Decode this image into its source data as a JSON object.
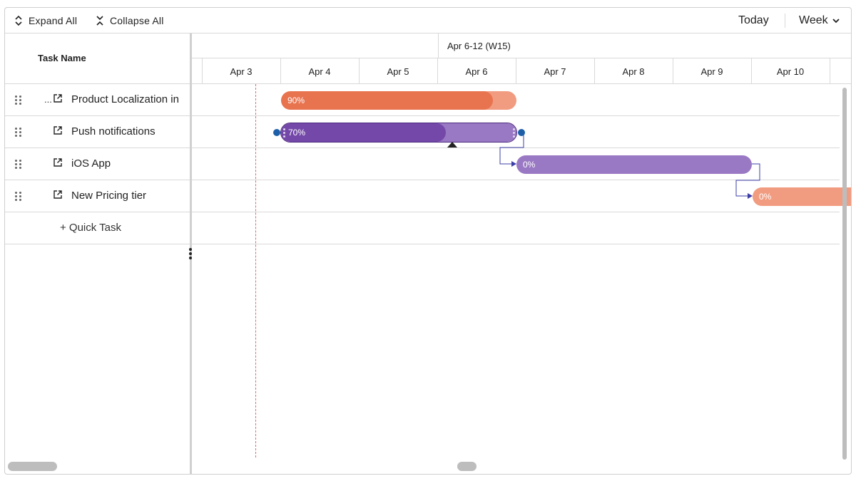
{
  "toolbar": {
    "expand_all": "Expand All",
    "collapse_all": "Collapse All",
    "today": "Today",
    "view_mode": "Week"
  },
  "grid": {
    "header": "Task Name",
    "tasks": [
      {
        "label": "Product Localization in",
        "collapsed_prefix": "..."
      },
      {
        "label": "Push notifications"
      },
      {
        "label": "iOS App"
      },
      {
        "label": "New Pricing tier"
      }
    ],
    "quick_task": "+ Quick Task"
  },
  "timeline": {
    "week_label": "Apr 6-12 (W15)",
    "days": [
      "Apr 3",
      "Apr 4",
      "Apr 5",
      "Apr 6",
      "Apr 7",
      "Apr 8",
      "Apr 9",
      "Apr 10"
    ],
    "bars": [
      {
        "task": "Product Localization in",
        "progress_label": "90%",
        "progress": 0.9
      },
      {
        "task": "Push notifications",
        "progress_label": "70%",
        "progress": 0.7
      },
      {
        "task": "iOS App",
        "progress_label": "0%",
        "progress": 0
      },
      {
        "task": "New Pricing tier",
        "progress_label": "0%",
        "progress": 0
      }
    ]
  },
  "colors": {
    "orange_fill": "#e8734f",
    "orange_light": "#f19c80",
    "purple_fill": "#7448a9",
    "purple_light": "#9a79c4",
    "dependency": "#3d3fa8",
    "today_line": "#e06a6a"
  }
}
